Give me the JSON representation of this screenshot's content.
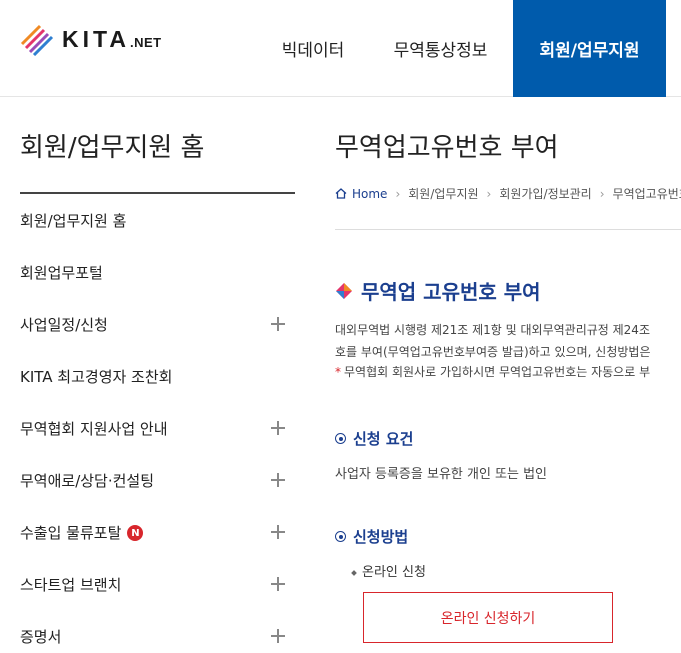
{
  "header": {
    "logo": {
      "text": "KITA",
      "suffix": ".NET"
    },
    "nav": [
      {
        "label": "빅데이터"
      },
      {
        "label": "무역통상정보"
      },
      {
        "label": "회원/업무지원"
      }
    ],
    "active_color": "#005bac"
  },
  "sidebar": {
    "title": "회원/업무지원 홈",
    "items": [
      {
        "label": "회원/업무지원 홈",
        "expandable": false
      },
      {
        "label": "회원업무포털",
        "expandable": false
      },
      {
        "label": "사업일정/신청",
        "expandable": true
      },
      {
        "label": "KITA 최고경영자 조찬회",
        "expandable": false
      },
      {
        "label": "무역협회 지원사업 안내",
        "expandable": true
      },
      {
        "label": "무역애로/상담·컨설팅",
        "expandable": true
      },
      {
        "label": "수출입 물류포탈",
        "expandable": true,
        "badge": "N"
      },
      {
        "label": "스타트업 브랜치",
        "expandable": true
      },
      {
        "label": "증명서",
        "expandable": true
      }
    ]
  },
  "main": {
    "title": "무역업고유번호 부여",
    "breadcrumb": [
      "Home",
      "회원/업무지원",
      "회원가입/정보관리",
      "무역업고유번호"
    ],
    "section_title": "무역업 고유번호 부여",
    "desc_line1": "대외무역법 시행령 제21조 제1항 및 대외무역관리규정 제24조",
    "desc_line2": "호를 부여(무역업고유번호부여증 발급)하고 있으며, 신청방법은",
    "note": "무역협회 회원사로 가입하시면 무역업고유번호는 자동으로 부",
    "note_mark": "*",
    "requirements_heading": "신청 요건",
    "requirements_text": "사업자 등록증을 보유한 개인 또는 법인",
    "method_heading": "신청방법",
    "method_item": "온라인 신청",
    "apply_button": "온라인 신청하기",
    "accent_color": "#1b3f8f",
    "button_color": "#d8262c"
  }
}
